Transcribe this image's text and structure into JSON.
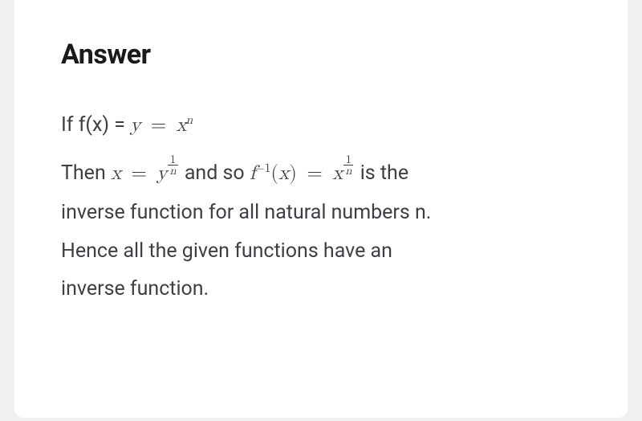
{
  "heading": "Answer",
  "body": {
    "line1_pre": "If f(x) =  ",
    "eq1_y": "y",
    "eq1_eq": "=",
    "eq1_x": "x",
    "eq1_sup": "n",
    "line2_pre": "Then ",
    "eq2_x": "x",
    "eq2_eq": "=",
    "eq2_y": "y",
    "frac_num": "1",
    "frac_den": "n",
    "line2_mid": " and so ",
    "eq3_f": "f",
    "eq3_supneg1": "−1",
    "eq3_lp": "(",
    "eq3_arg": "x",
    "eq3_rp": ")",
    "eq3_eq": "=",
    "eq3_x": "x",
    "line2_post": " is the",
    "line3": "inverse function for all natural numbers n.",
    "line4": "Hence all the given functions have an",
    "line5": "inverse function."
  }
}
